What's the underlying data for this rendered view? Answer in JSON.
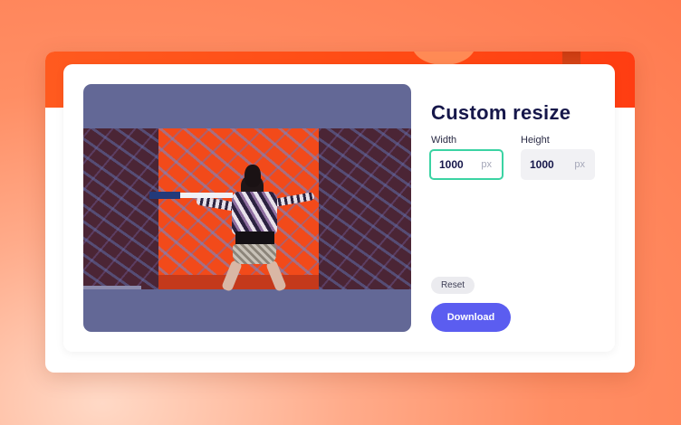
{
  "dialog": {
    "title": "Custom resize",
    "width": {
      "label": "Width",
      "value": "1000",
      "unit": "px"
    },
    "height": {
      "label": "Height",
      "value": "1000",
      "unit": "px"
    },
    "reset_label": "Reset",
    "download_label": "Download"
  },
  "colors": {
    "accent": "#5b5df0",
    "focus_border": "#3bd3a3",
    "title_text": "#16174a",
    "preview_bg": "#636896",
    "background": "#ff8e64"
  }
}
